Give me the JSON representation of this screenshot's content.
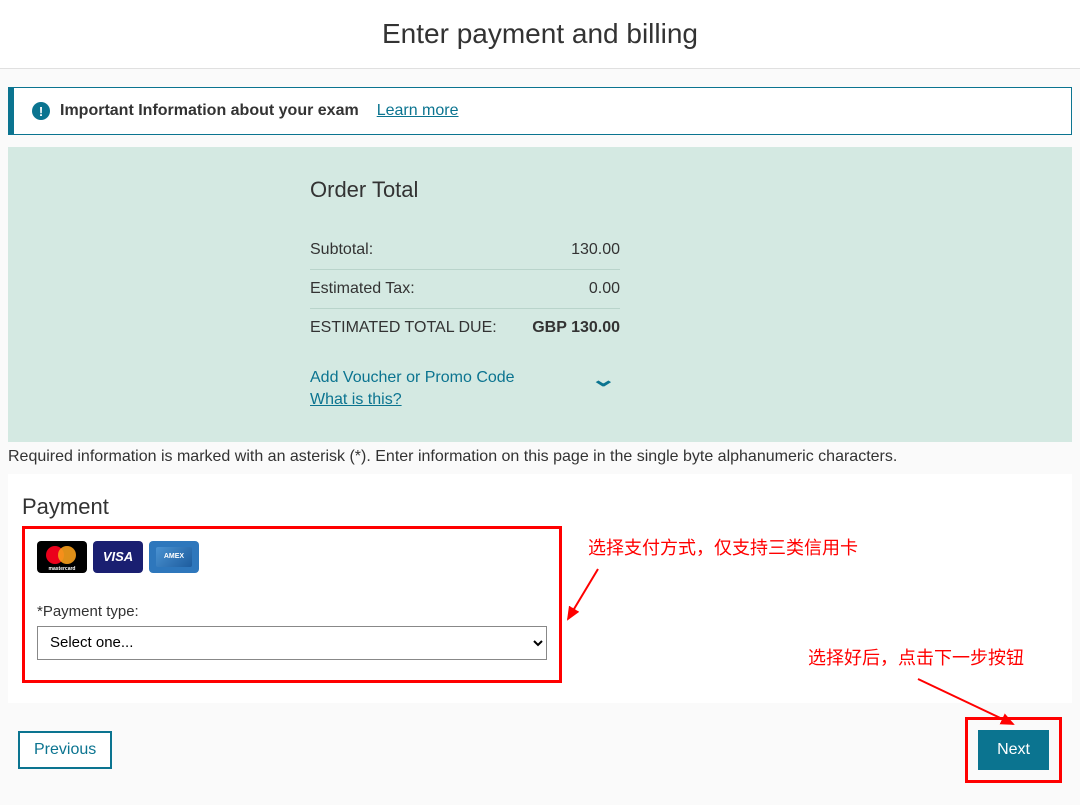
{
  "header": {
    "title": "Enter payment and billing"
  },
  "alert": {
    "text": "Important Information about your exam",
    "link_label": "Learn more"
  },
  "order": {
    "title": "Order Total",
    "subtotal_label": "Subtotal:",
    "subtotal_value": "130.00",
    "tax_label": "Estimated Tax:",
    "tax_value": "0.00",
    "total_label": "ESTIMATED TOTAL DUE:",
    "total_value": "GBP 130.00",
    "voucher_link": "Add Voucher or Promo Code",
    "what_link": "What is this?"
  },
  "required_note": "Required information is marked with an asterisk (*). Enter information on this page in the single byte alphanumeric characters.",
  "payment": {
    "section_title": "Payment",
    "type_label": "*Payment type:",
    "select_placeholder": "Select one...",
    "cards": {
      "mastercard": "mastercard",
      "visa": "VISA",
      "amex": "AMEX"
    }
  },
  "annotations": {
    "a1": "选择支付方式，仅支持三类信用卡",
    "a2": "选择好后，点击下一步按钮"
  },
  "nav": {
    "previous": "Previous",
    "next": "Next"
  }
}
